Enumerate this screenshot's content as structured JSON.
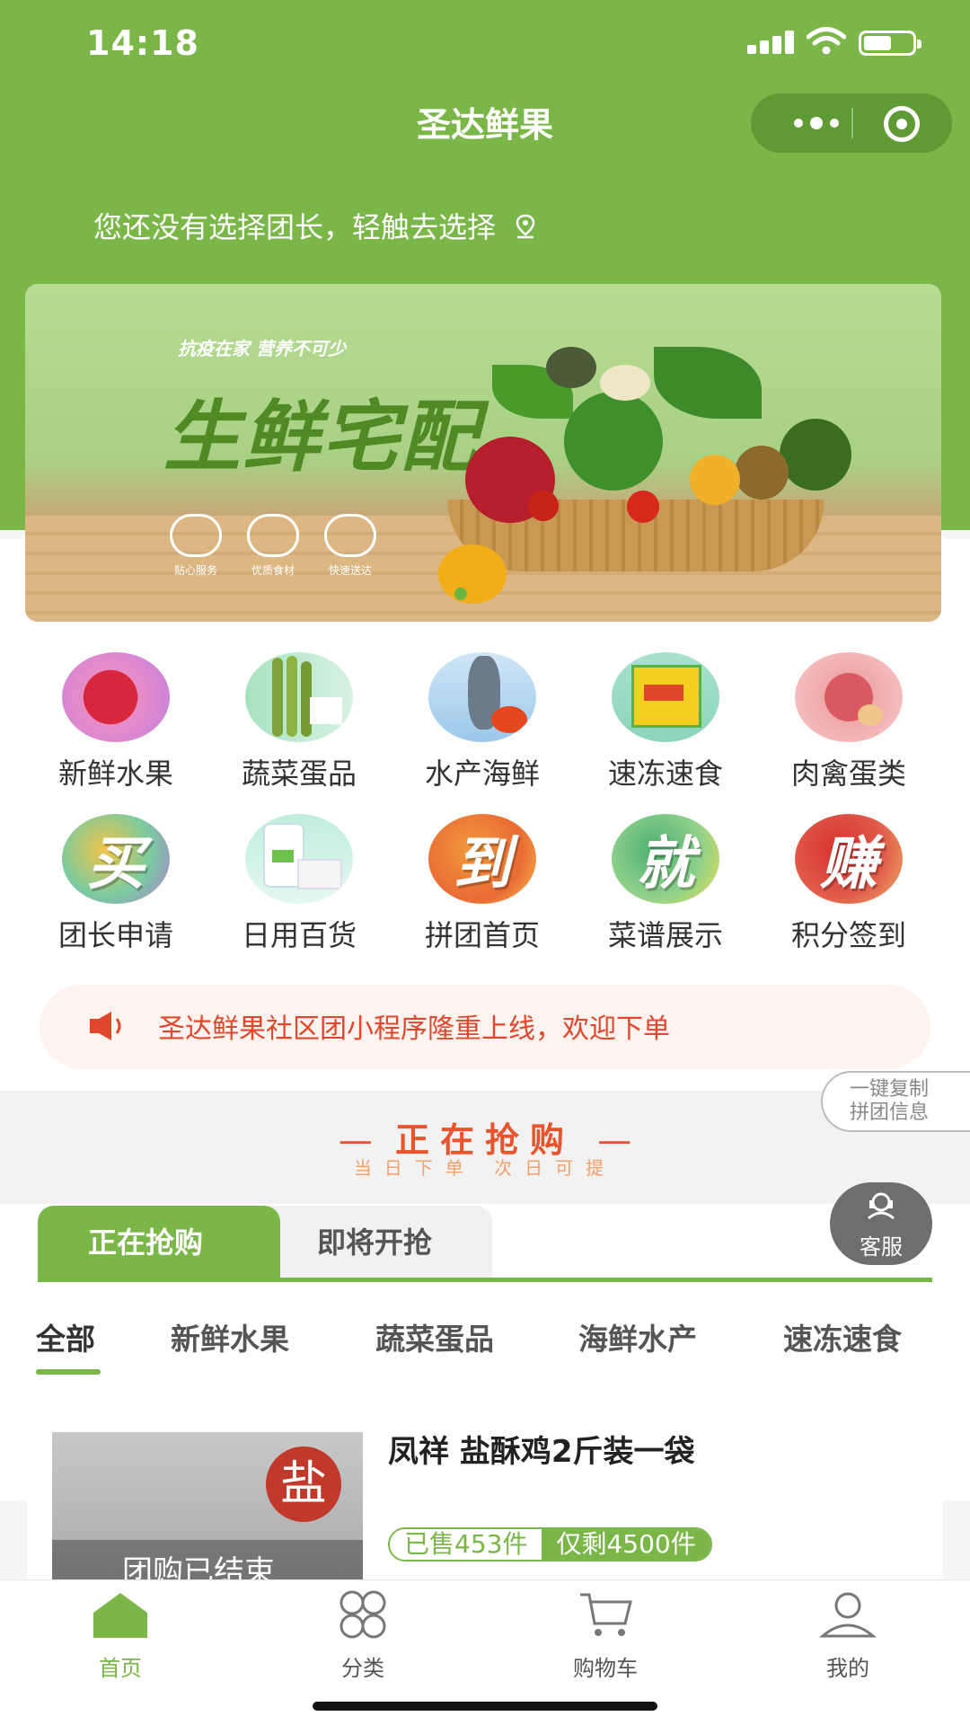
{
  "status_bar": {
    "time": "14:18"
  },
  "nav": {
    "title": "圣达鲜果"
  },
  "leader_hint": "您还没有选择团长，轻触去选择",
  "banner": {
    "small_text": "抗疫在家 营养不可少",
    "big_text": "生鲜宅配",
    "badges": [
      "贴心服务",
      "优质食材",
      "快速送达"
    ]
  },
  "categories": [
    {
      "label": "新鲜水果",
      "icon": "apple-icon"
    },
    {
      "label": "蔬菜蛋品",
      "icon": "asparagus-icon"
    },
    {
      "label": "水产海鲜",
      "icon": "fish-icon"
    },
    {
      "label": "速冻速食",
      "icon": "frozen-food-icon"
    },
    {
      "label": "肉禽蛋类",
      "icon": "meat-icon"
    },
    {
      "label": "团长申请",
      "icon": "buy-icon",
      "glyph": "买"
    },
    {
      "label": "日用百货",
      "icon": "daily-goods-icon"
    },
    {
      "label": "拼团首页",
      "icon": "arrive-icon",
      "glyph": "到"
    },
    {
      "label": "菜谱展示",
      "icon": "just-icon",
      "glyph": "就"
    },
    {
      "label": "积分签到",
      "icon": "earn-icon",
      "glyph": "赚"
    }
  ],
  "notice": "圣达鲜果社区团小程序隆重上线，欢迎下单",
  "copy_tag": {
    "line1": "一键复制",
    "line2": "拼团信息"
  },
  "grab_section": {
    "title": "正在抢购",
    "subtitle": "当日下单 次日可提",
    "dash": "—"
  },
  "tabs": {
    "active": "正在抢购",
    "inactive": "即将开抢"
  },
  "service": "客服",
  "subtabs": [
    "全部",
    "新鲜水果",
    "蔬菜蛋品",
    "海鲜水产",
    "速冻速食"
  ],
  "product": {
    "title": "凤祥 盐酥鸡2斤装一袋",
    "sold": "已售453件",
    "left": "仅剩4500件",
    "ended": "团购已结束",
    "salt": "盐"
  },
  "tabbar": [
    "首页",
    "分类",
    "购物车",
    "我的"
  ],
  "colors": {
    "brand_green": "#7ab648",
    "notice_red": "#e0472c",
    "grab_orange": "#e8542d"
  }
}
